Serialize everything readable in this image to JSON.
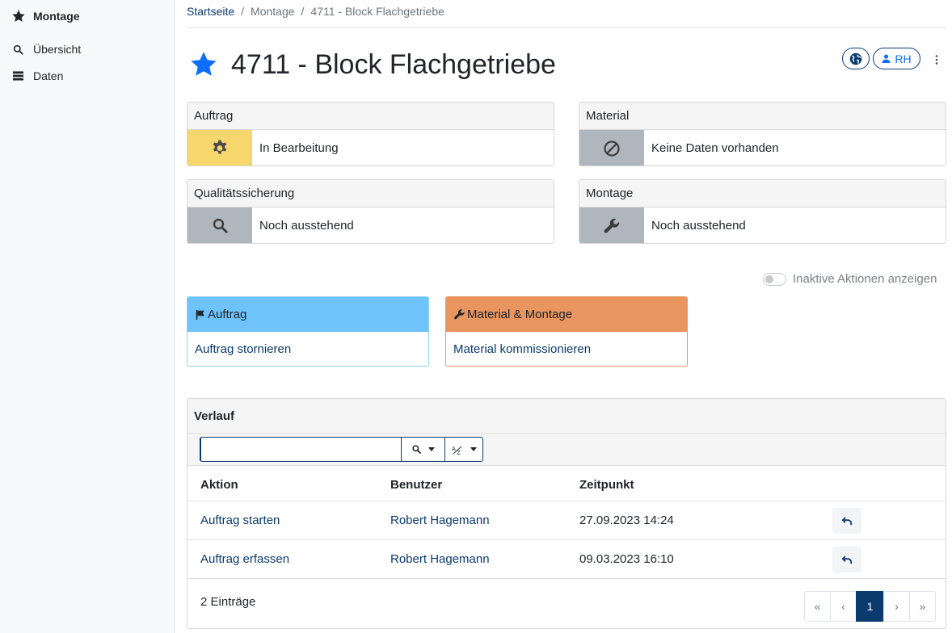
{
  "sidebar": {
    "title": "Montage",
    "title_icon": "star-icon",
    "items": [
      {
        "label": "Übersicht",
        "icon": "search-icon"
      },
      {
        "label": "Daten",
        "icon": "list-icon"
      }
    ]
  },
  "breadcrumb": {
    "home": "Startseite",
    "sep": "/",
    "section": "Montage",
    "current": "4711 - Block Flachgetriebe"
  },
  "page": {
    "title": "4711 - Block Flachgetriebe",
    "star_color": "#0d6efd",
    "user_initials": "RH"
  },
  "status_cards": [
    {
      "header": "Auftrag",
      "status": "In Bearbeitung",
      "icon": "gear-icon",
      "color": "#f5d76e"
    },
    {
      "header": "Material",
      "status": "Keine Daten vorhanden",
      "icon": "ban-icon",
      "color": "#b0b6bd"
    },
    {
      "header": "Qualitätssicherung",
      "status": "Noch ausstehend",
      "icon": "search-icon",
      "color": "#b0b6bd"
    },
    {
      "header": "Montage",
      "status": "Noch ausstehend",
      "icon": "wrench-icon",
      "color": "#b0b6bd"
    }
  ],
  "toggle": {
    "label": "Inaktive Aktionen anzeigen",
    "checked": false
  },
  "action_cards": [
    {
      "header": "Auftrag",
      "icon": "flag-icon",
      "action": "Auftrag stornieren",
      "color": "#6ec3fb"
    },
    {
      "header": "Material & Montage",
      "icon": "wrench-icon",
      "action": "Material kommissionieren",
      "color": "#e8955f"
    }
  ],
  "history": {
    "title": "Verlauf",
    "search_value": "",
    "columns": [
      "Aktion",
      "Benutzer",
      "Zeitpunkt"
    ],
    "rows": [
      {
        "action": "Auftrag starten",
        "user": "Robert Hagemann",
        "time": "27.09.2023 14:24"
      },
      {
        "action": "Auftrag erfassen",
        "user": "Robert Hagemann",
        "time": "09.03.2023 16:10"
      }
    ],
    "count_label": "2 Einträge",
    "pagination": {
      "first": "«",
      "prev": "‹",
      "current": "1",
      "next": "›",
      "last": "»"
    }
  }
}
